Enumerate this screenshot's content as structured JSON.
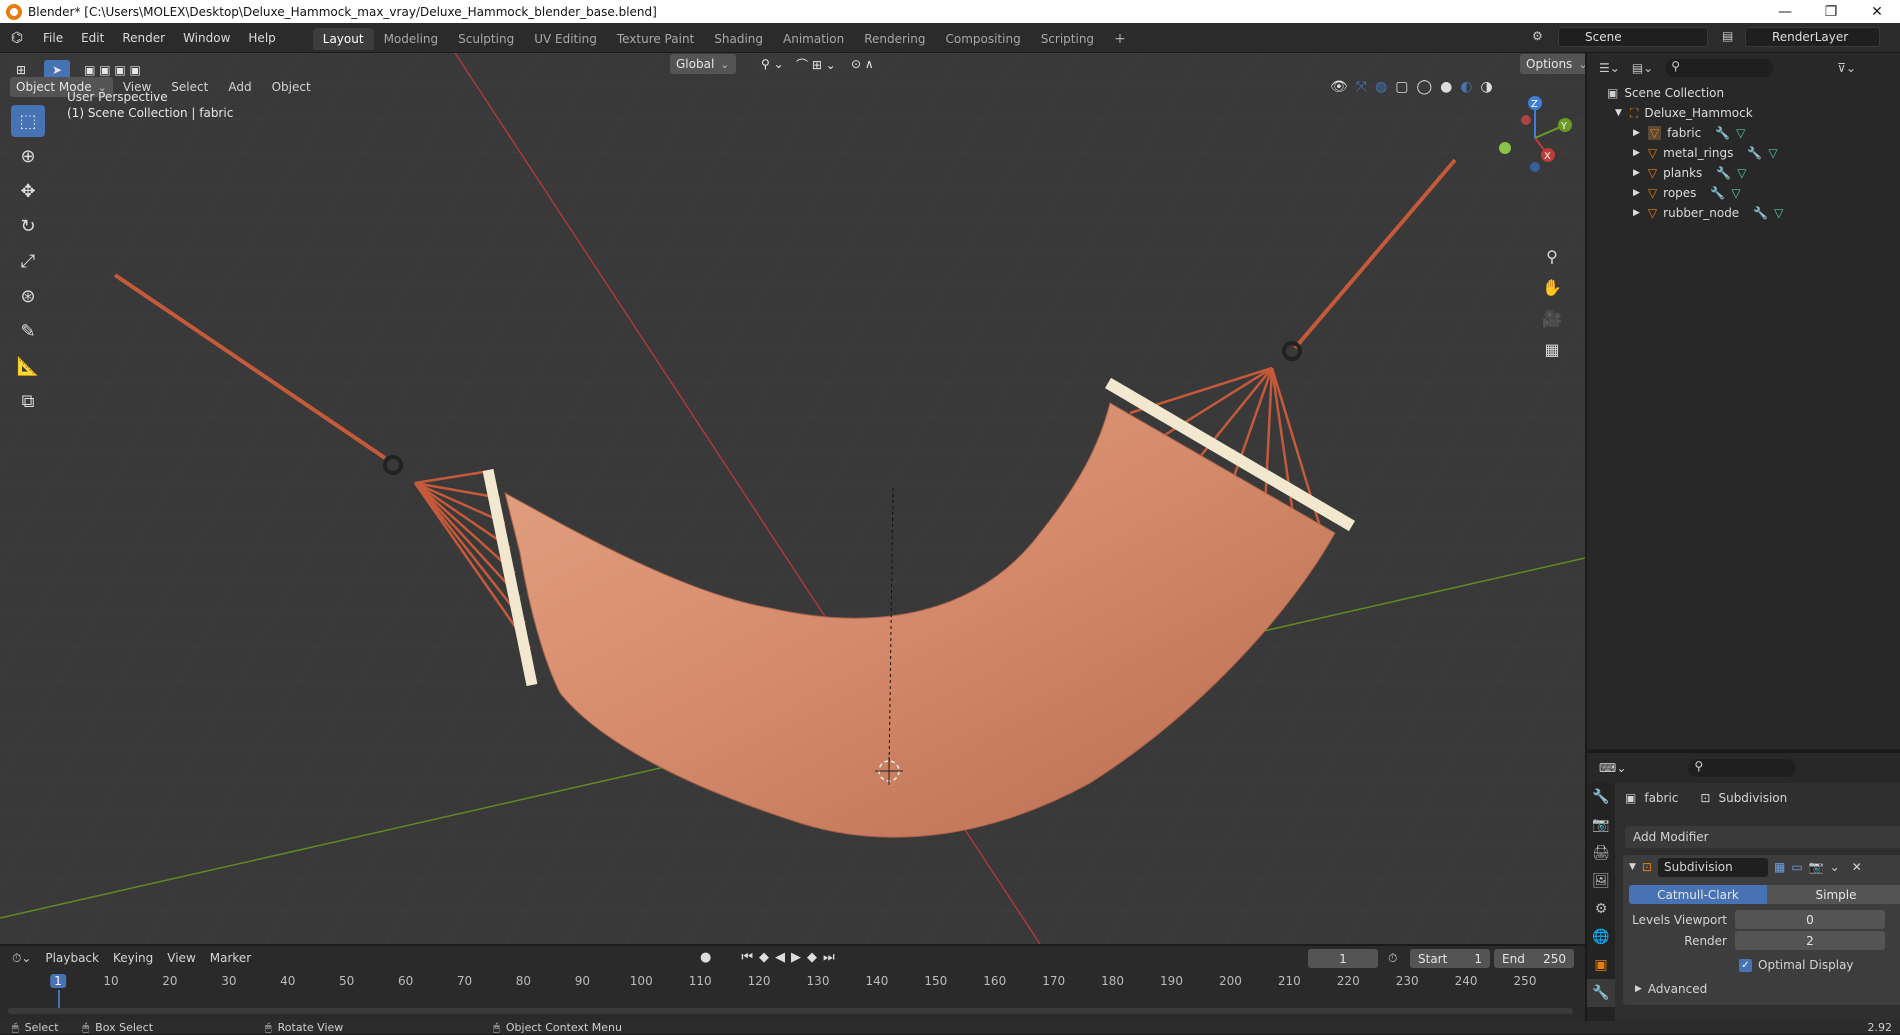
{
  "window": {
    "title": "Blender* [C:\\Users\\MOLEX\\Desktop\\Deluxe_Hammock_max_vray/Deluxe_Hammock_blender_base.blend]"
  },
  "menu": [
    "File",
    "Edit",
    "Render",
    "Window",
    "Help"
  ],
  "workspaces": [
    "Layout",
    "Modeling",
    "Sculpting",
    "UV Editing",
    "Texture Paint",
    "Shading",
    "Animation",
    "Rendering",
    "Compositing",
    "Scripting"
  ],
  "scene": {
    "name": "Scene",
    "render_layer": "RenderLayer"
  },
  "viewport": {
    "mode": "Object Mode",
    "menus": [
      "View",
      "Select",
      "Add",
      "Object"
    ],
    "transform": "Global",
    "options": "Options",
    "info_line1": "User Perspective",
    "info_line2": "(1) Scene Collection | fabric",
    "gizmo": {
      "x": "X",
      "y": "Y",
      "z": "Z"
    }
  },
  "outliner": {
    "root": "Scene Collection",
    "collection": "Deluxe_Hammock",
    "objects": [
      "fabric",
      "metal_rings",
      "planks",
      "ropes",
      "rubber_node"
    ]
  },
  "properties": {
    "object": "fabric",
    "modifier_breadcrumb": "Subdivision",
    "add_modifier": "Add Modifier",
    "modifier_name": "Subdivision",
    "mode_a": "Catmull-Clark",
    "mode_b": "Simple",
    "levels_viewport_label": "Levels Viewport",
    "levels_viewport": "0",
    "render_label": "Render",
    "render": "2",
    "optimal_display": "Optimal Display",
    "advanced": "Advanced"
  },
  "timeline": {
    "menus": [
      "Playback",
      "Keying",
      "View",
      "Marker"
    ],
    "current_frame": "1",
    "start_label": "Start",
    "start": "1",
    "end_label": "End",
    "end": "250",
    "ticks": [
      "1",
      "10",
      "20",
      "30",
      "40",
      "50",
      "60",
      "70",
      "80",
      "90",
      "100",
      "110",
      "120",
      "130",
      "140",
      "150",
      "160",
      "170",
      "180",
      "190",
      "200",
      "210",
      "220",
      "230",
      "240",
      "250"
    ]
  },
  "status": {
    "select": "Select",
    "box_select": "Box Select",
    "rotate": "Rotate View",
    "context": "Object Context Menu",
    "version": "2.92"
  },
  "colors": {
    "accent": "#4772b3",
    "fabric": "#d4896a",
    "rope": "#c55a3a",
    "plank": "#f2e8cf",
    "x_axis": "#b8393a",
    "y_axis": "#6b9a25",
    "active_orange": "#e87d0d"
  }
}
